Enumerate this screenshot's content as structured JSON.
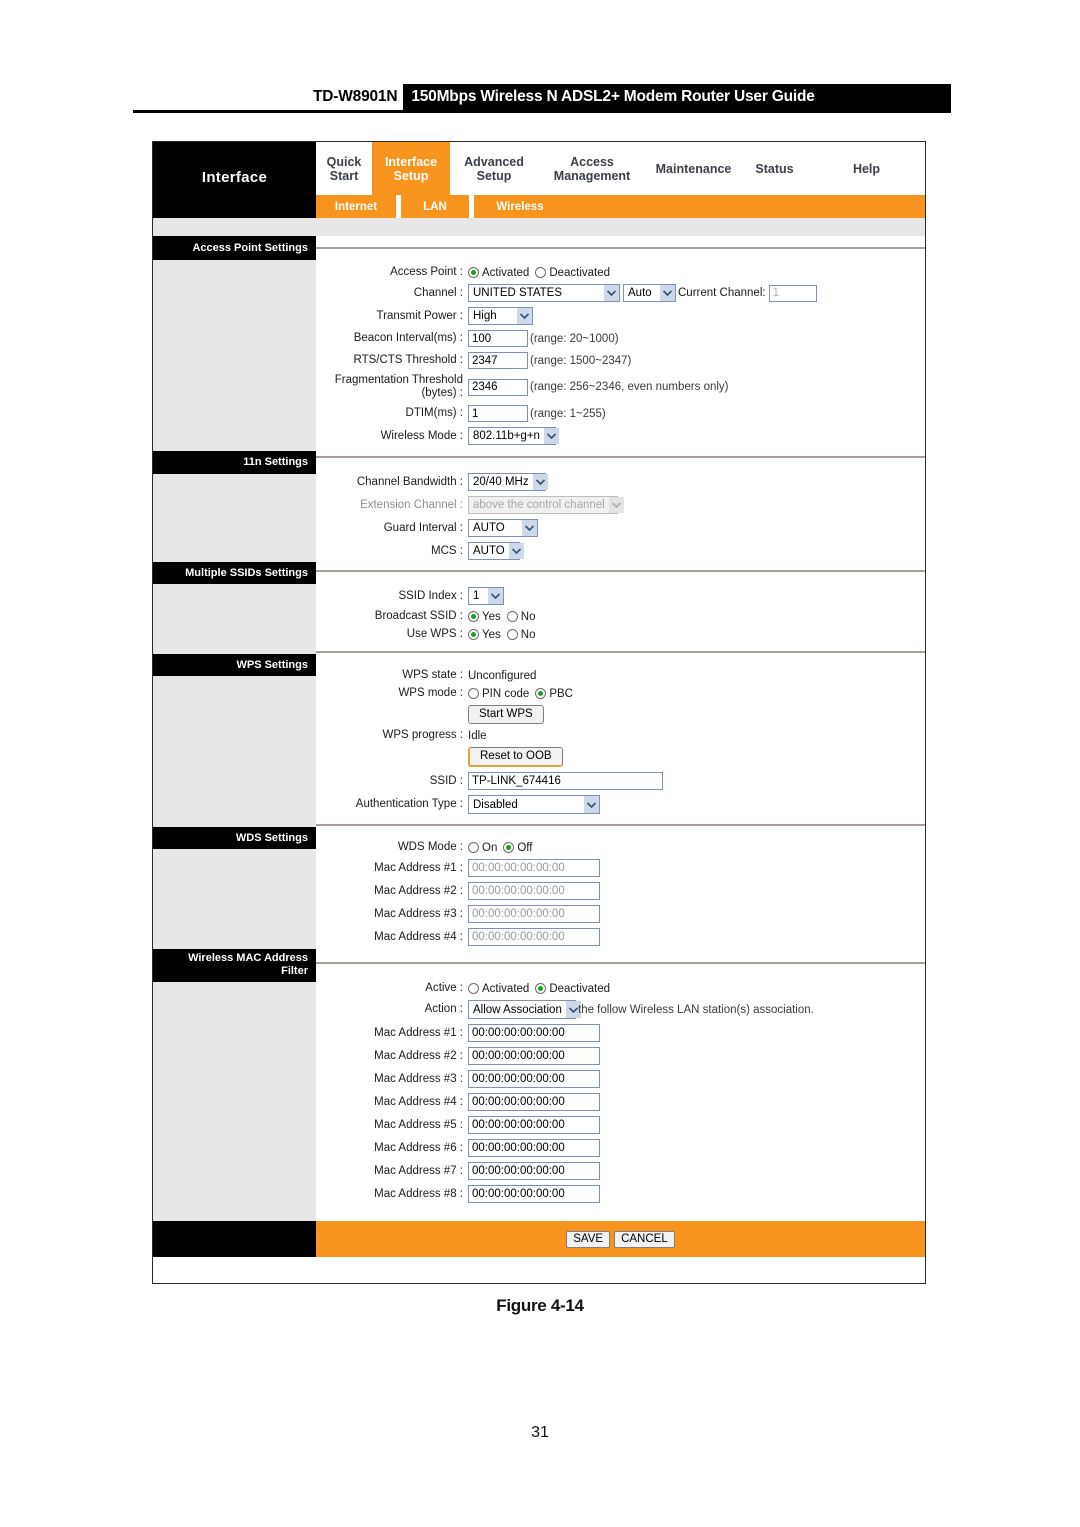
{
  "doc": {
    "model": "TD-W8901N",
    "title": "150Mbps Wireless N ADSL2+ Modem Router User Guide",
    "figure_caption": "Figure 4-14",
    "page_number": "31"
  },
  "nav": {
    "brand": "Interface",
    "tabs": [
      {
        "label": "Quick\nStart",
        "active": false
      },
      {
        "label": "Interface\nSetup",
        "active": true
      },
      {
        "label": "Advanced\nSetup",
        "active": false
      },
      {
        "label": "Access\nManagement",
        "active": false
      },
      {
        "label": "Maintenance",
        "active": false
      },
      {
        "label": "Status",
        "active": false
      },
      {
        "label": "Help",
        "active": false
      }
    ],
    "subtabs": [
      {
        "label": "Internet"
      },
      {
        "label": "LAN"
      },
      {
        "label": "Wireless"
      }
    ]
  },
  "sections": {
    "access_point": {
      "heading": "Access Point Settings",
      "access_point_label": "Access Point :",
      "access_point_options": [
        "Activated",
        "Deactivated"
      ],
      "access_point_selected": "Activated",
      "channel_label": "Channel :",
      "channel_country": "UNITED STATES",
      "channel_mode": "Auto",
      "current_channel_label": "Current Channel:",
      "current_channel_value": "1",
      "transmit_power_label": "Transmit Power :",
      "transmit_power_value": "High",
      "beacon_label": "Beacon Interval(ms) :",
      "beacon_value": "100",
      "beacon_hint": "(range: 20~1000)",
      "rts_label": "RTS/CTS Threshold :",
      "rts_value": "2347",
      "rts_hint": "(range: 1500~2347)",
      "frag_label_line1": "Fragmentation Threshold",
      "frag_label_line2": "(bytes) :",
      "frag_value": "2346",
      "frag_hint": "(range: 256~2346, even numbers only)",
      "dtim_label": "DTIM(ms) :",
      "dtim_value": "1",
      "dtim_hint": "(range: 1~255)",
      "wireless_mode_label": "Wireless Mode :",
      "wireless_mode_value": "802.11b+g+n"
    },
    "eleven_n": {
      "heading": "11n Settings",
      "channel_bandwidth_label": "Channel Bandwidth :",
      "channel_bandwidth_value": "20/40 MHz",
      "extension_channel_label": "Extension Channel :",
      "extension_channel_value": "above the control channel",
      "guard_interval_label": "Guard Interval :",
      "guard_interval_value": "AUTO",
      "mcs_label": "MCS :",
      "mcs_value": "AUTO"
    },
    "multiple_ssids": {
      "heading": "Multiple SSIDs Settings",
      "ssid_index_label": "SSID Index :",
      "ssid_index_value": "1",
      "broadcast_ssid_label": "Broadcast SSID :",
      "broadcast_ssid_options": [
        "Yes",
        "No"
      ],
      "broadcast_ssid_selected": "Yes",
      "use_wps_label": "Use WPS :",
      "use_wps_options": [
        "Yes",
        "No"
      ],
      "use_wps_selected": "Yes"
    },
    "wps": {
      "heading": "WPS Settings",
      "wps_state_label": "WPS state :",
      "wps_state_value": "Unconfigured",
      "wps_mode_label": "WPS mode :",
      "wps_mode_options": [
        "PIN code",
        "PBC"
      ],
      "wps_mode_selected": "PBC",
      "start_wps_button": "Start WPS",
      "wps_progress_label": "WPS progress :",
      "wps_progress_value": "Idle",
      "reset_oob_button": "Reset to OOB",
      "ssid_label": "SSID :",
      "ssid_value": "TP-LINK_674416",
      "auth_type_label": "Authentication Type :",
      "auth_type_value": "Disabled"
    },
    "wds": {
      "heading": "WDS Settings",
      "wds_mode_label": "WDS Mode :",
      "wds_mode_options": [
        "On",
        "Off"
      ],
      "wds_mode_selected": "Off",
      "mac_rows": [
        {
          "label": "Mac Address #1 :",
          "value": "00:00:00:00:00:00"
        },
        {
          "label": "Mac Address #2 :",
          "value": "00:00:00:00:00:00"
        },
        {
          "label": "Mac Address #3 :",
          "value": "00:00:00:00:00:00"
        },
        {
          "label": "Mac Address #4 :",
          "value": "00:00:00:00:00:00"
        }
      ]
    },
    "mac_filter": {
      "heading_line1": "Wireless MAC Address",
      "heading_line2": "Filter",
      "active_label": "Active :",
      "active_options": [
        "Activated",
        "Deactivated"
      ],
      "active_selected": "Deactivated",
      "action_label": "Action :",
      "action_value": "Allow Association",
      "action_suffix": "the follow Wireless LAN station(s) association.",
      "mac_rows": [
        {
          "label": "Mac Address #1 :",
          "value": "00:00:00:00:00:00"
        },
        {
          "label": "Mac Address #2 :",
          "value": "00:00:00:00:00:00"
        },
        {
          "label": "Mac Address #3 :",
          "value": "00:00:00:00:00:00"
        },
        {
          "label": "Mac Address #4 :",
          "value": "00:00:00:00:00:00"
        },
        {
          "label": "Mac Address #5 :",
          "value": "00:00:00:00:00:00"
        },
        {
          "label": "Mac Address #6 :",
          "value": "00:00:00:00:00:00"
        },
        {
          "label": "Mac Address #7 :",
          "value": "00:00:00:00:00:00"
        },
        {
          "label": "Mac Address #8 :",
          "value": "00:00:00:00:00:00"
        }
      ]
    }
  },
  "footer": {
    "save_label": "SAVE",
    "cancel_label": "CANCEL"
  },
  "colors": {
    "accent": "#F7941E",
    "header_black": "#000000",
    "panel_gray": "#e7e7e7",
    "rule": "#a9a293",
    "radio_dot": "#16a516"
  }
}
